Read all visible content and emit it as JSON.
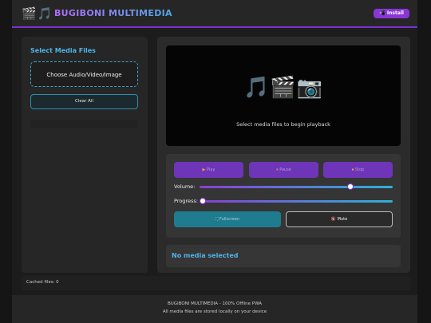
{
  "header": {
    "logo_icons": "🎬🎵",
    "title": "BUGIBONI MULTIMEDIA",
    "install_label": "📲 Install"
  },
  "sidebar": {
    "title": "Select Media Files",
    "choose_label": "Choose Audio/Video/Image",
    "clear_label": "Clear All"
  },
  "viewer": {
    "icons": "🎵🎬📷",
    "message": "Select media files to begin playback"
  },
  "controls": {
    "play_icon": "▶",
    "play_label": "Play",
    "pause_icon": "⏸",
    "pause_label": "Pause",
    "stop_icon": "⏹",
    "stop_label": "Stop",
    "volume_label": "Volume:",
    "volume_value": 0.79,
    "progress_label": "Progress:",
    "progress_value": 0,
    "fullscreen_icon": "⛶",
    "fullscreen_label": "Fullscreen",
    "mute_icon": "🔇",
    "mute_label": "Mute"
  },
  "media_info": {
    "title": "No media selected"
  },
  "status": {
    "cached_files": "Cached files: 0"
  },
  "footer": {
    "line1": "BUGIBONI MULTIMEDIA - 100% Offline PWA",
    "line2": "All media files are stored locally on your device"
  },
  "colors": {
    "accent_purple": "#8a35d8",
    "accent_cyan": "#4fb4e6",
    "background": "#151515"
  }
}
